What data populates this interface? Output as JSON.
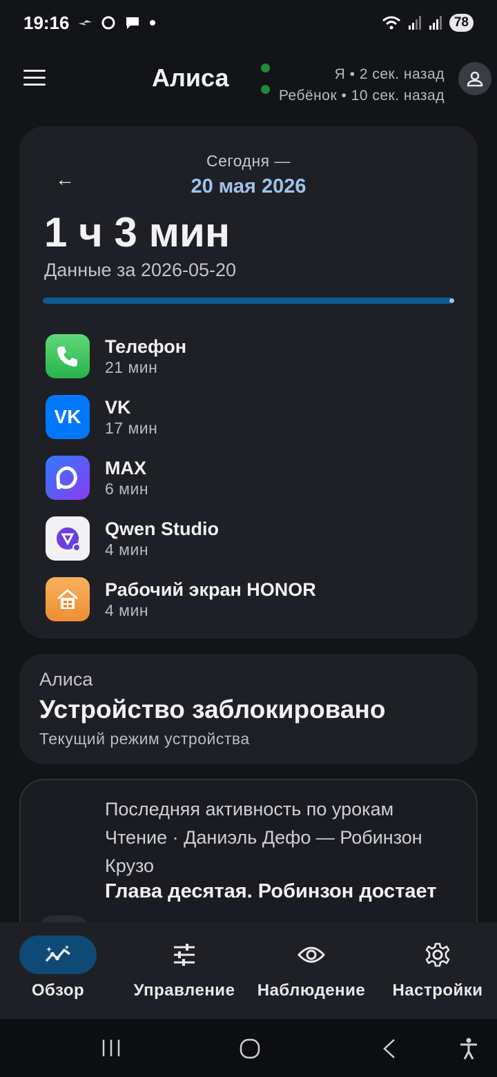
{
  "status_bar": {
    "time": "19:16",
    "battery": "78",
    "icons_left": [
      "airplane-like-icon",
      "max-app-icon",
      "chat-bubble-icon",
      "dot-icon"
    ],
    "icons_right": [
      "wifi-icon",
      "signal-icon",
      "signal-icon",
      "battery-icon"
    ]
  },
  "header": {
    "title": "Алиса",
    "presence": [
      {
        "label": "Я • 2 сек. назад",
        "status_color": "#1f8a3a"
      },
      {
        "label": "Ребёнок • 10 сек. назад",
        "status_color": "#1f8a3a"
      }
    ]
  },
  "usage_card": {
    "today_label": "Сегодня —",
    "date": "20 мая 2026",
    "total": "1 ч 3 мин",
    "data_for": "Данные за 2026-05-20",
    "progress": 1.0,
    "apps": [
      {
        "name": "Телефон",
        "time": "21 мин",
        "icon": "phone-icon",
        "color": "#3bc25c"
      },
      {
        "name": "VK",
        "time": "17 мин",
        "icon": "vk-icon",
        "color": "#0077ff"
      },
      {
        "name": "MAX",
        "time": "6 мин",
        "icon": "max-icon",
        "color": "#5a4cf0"
      },
      {
        "name": "Qwen Studio",
        "time": "4 мин",
        "icon": "qwen-icon",
        "color": "#f2f2f5"
      },
      {
        "name": "Рабочий экран HONOR",
        "time": "4 мин",
        "icon": "home-icon",
        "color": "#f3a24a"
      }
    ]
  },
  "mode_card": {
    "owner": "Алиса",
    "mode": "Устройство заблокировано",
    "caption": "Текущий режим устройства"
  },
  "lessons_card": {
    "heading": "Последняя активность по урокам",
    "subject": "Чтение · Даниэль Дефо — Робинзон Крузо",
    "chapter": "Глава десятая. Робинзон достает"
  },
  "bottom_nav": [
    {
      "label": "Обзор",
      "icon": "overview-chart-icon",
      "active": true
    },
    {
      "label": "Управление",
      "icon": "sliders-icon",
      "active": false
    },
    {
      "label": "Наблюдение",
      "icon": "eye-icon",
      "active": false
    },
    {
      "label": "Настройки",
      "icon": "gear-icon",
      "active": false
    }
  ],
  "colors": {
    "background": "#131417",
    "card": "#1f2025",
    "accent": "#9ec2ee",
    "active_nav": "#0e4a75"
  }
}
